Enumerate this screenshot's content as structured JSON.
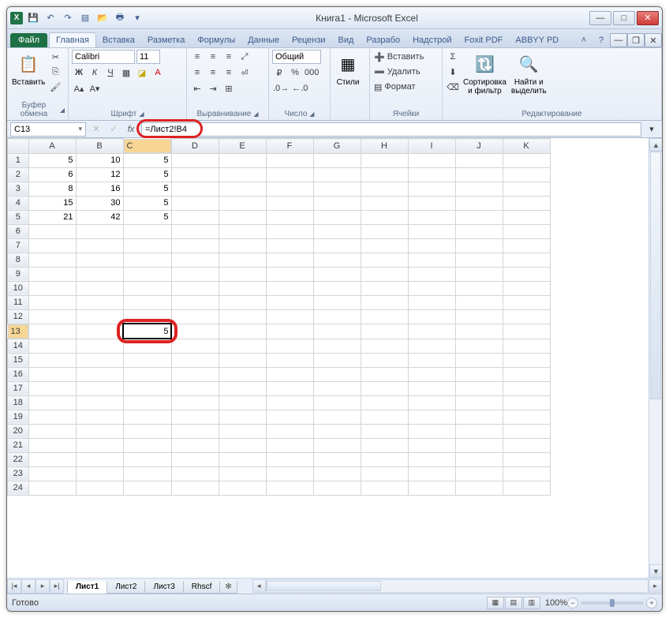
{
  "title": "Книга1  -  Microsoft Excel",
  "qat_icons": [
    "save-icon",
    "undo-icon",
    "redo-icon",
    "new-icon",
    "open-icon",
    "print-icon",
    "quickprint-icon"
  ],
  "window_buttons": {
    "minimize": "—",
    "maximize": "□",
    "close": "✕"
  },
  "ribbon_tabs": {
    "file": "Файл",
    "items": [
      "Главная",
      "Вставка",
      "Разметка",
      "Формулы",
      "Данные",
      "Рецензи",
      "Вид",
      "Разрабо",
      "Надстрой",
      "Foxit PDF",
      "ABBYY PD"
    ],
    "active_index": 0
  },
  "ribbon": {
    "clipboard": {
      "label": "Буфер обмена",
      "paste": "Вставить"
    },
    "font": {
      "label": "Шрифт",
      "name": "Calibri",
      "size": "11"
    },
    "alignment": {
      "label": "Выравнивание"
    },
    "number": {
      "label": "Число",
      "format": "Общий"
    },
    "styles": {
      "label": "Стили",
      "styles_btn": "Стили"
    },
    "cells": {
      "label": "Ячейки",
      "insert": "Вставить",
      "delete": "Удалить",
      "format": "Формат"
    },
    "editing": {
      "label": "Редактирование",
      "sort": "Сортировка\nи фильтр",
      "find": "Найти и\nвыделить"
    }
  },
  "namebox": "C13",
  "formula": "=Лист2!B4",
  "columns": [
    "A",
    "B",
    "C",
    "D",
    "E",
    "F",
    "G",
    "H",
    "I",
    "J",
    "K"
  ],
  "row_count": 24,
  "selected_row": 13,
  "selected_col": 2,
  "cells": {
    "1": {
      "A": "5",
      "B": "10",
      "C": "5"
    },
    "2": {
      "A": "6",
      "B": "12",
      "C": "5"
    },
    "3": {
      "A": "8",
      "B": "16",
      "C": "5"
    },
    "4": {
      "A": "15",
      "B": "30",
      "C": "5"
    },
    "5": {
      "A": "21",
      "B": "42",
      "C": "5"
    },
    "13": {
      "C": "5"
    }
  },
  "sheet_tabs": [
    "Лист1",
    "Лист2",
    "Лист3",
    "Rhscf"
  ],
  "active_sheet_index": 0,
  "status": "Готово",
  "zoom": "100%"
}
